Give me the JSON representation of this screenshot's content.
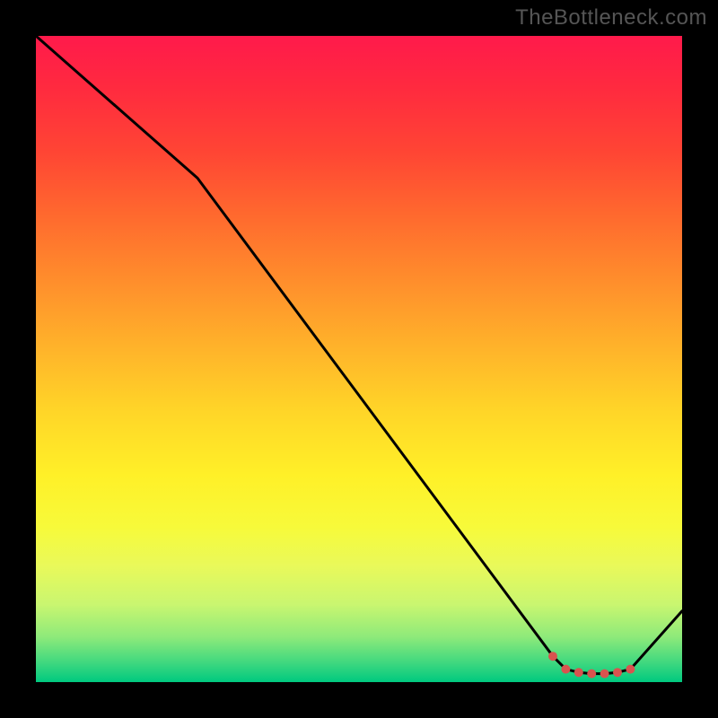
{
  "watermark": "TheBottleneck.com",
  "chart_data": {
    "type": "line",
    "title": "",
    "xlabel": "",
    "ylabel": "",
    "xlim": [
      0,
      100
    ],
    "ylim": [
      0,
      100
    ],
    "series": [
      {
        "name": "curve",
        "x": [
          0,
          25,
          80,
          82,
          84,
          86,
          88,
          90,
          92,
          100
        ],
        "values": [
          100,
          78,
          4,
          2,
          1.5,
          1.3,
          1.3,
          1.5,
          2,
          11
        ]
      }
    ],
    "markers": {
      "name": "bottom-cluster",
      "color": "#d9534f",
      "x": [
        80,
        82,
        84,
        86,
        88,
        90,
        92
      ],
      "values": [
        4,
        2,
        1.5,
        1.3,
        1.3,
        1.5,
        2
      ]
    },
    "gradient_stops": [
      {
        "pos": 0.0,
        "color": "#ff1a4b"
      },
      {
        "pos": 0.18,
        "color": "#ff4534"
      },
      {
        "pos": 0.38,
        "color": "#ff8e2c"
      },
      {
        "pos": 0.58,
        "color": "#ffd528"
      },
      {
        "pos": 0.76,
        "color": "#f7fa3a"
      },
      {
        "pos": 0.93,
        "color": "#8eea7a"
      },
      {
        "pos": 1.0,
        "color": "#00c97f"
      }
    ]
  }
}
